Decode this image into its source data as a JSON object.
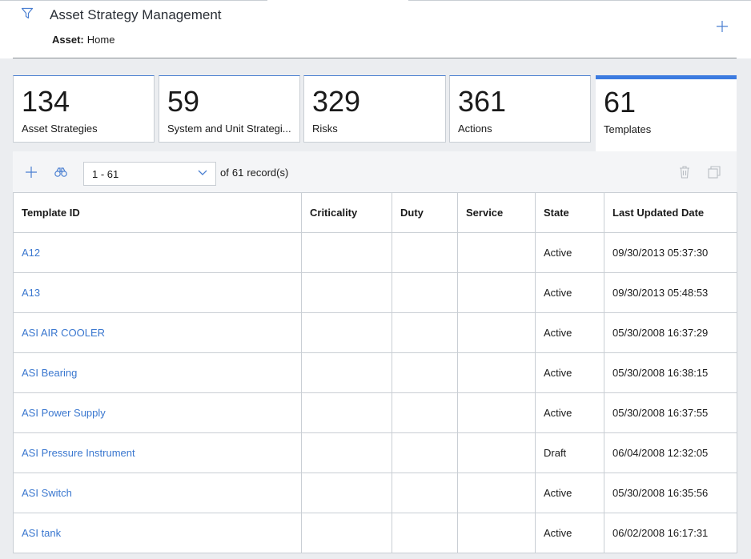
{
  "header": {
    "title": "Asset Strategy Management",
    "asset_label": "Asset:",
    "asset_value": "Home"
  },
  "cards": [
    {
      "count": "134",
      "label": "Asset Strategies"
    },
    {
      "count": "59",
      "label": "System and Unit Strategi..."
    },
    {
      "count": "329",
      "label": "Risks"
    },
    {
      "count": "361",
      "label": "Actions"
    },
    {
      "count": "61",
      "label": "Templates",
      "active": true
    }
  ],
  "toolbar": {
    "pager_value": "1 - 61",
    "of_label": "of",
    "total": "61",
    "records_label": "record(s)"
  },
  "table": {
    "columns": [
      "Template ID",
      "Criticality",
      "Duty",
      "Service",
      "State",
      "Last Updated Date"
    ],
    "rows": [
      {
        "id": "A12",
        "criticality": "",
        "duty": "",
        "service": "",
        "state": "Active",
        "updated": "09/30/2013 05:37:30"
      },
      {
        "id": "A13",
        "criticality": "",
        "duty": "",
        "service": "",
        "state": "Active",
        "updated": "09/30/2013 05:48:53"
      },
      {
        "id": "ASI AIR COOLER",
        "criticality": "",
        "duty": "",
        "service": "",
        "state": "Active",
        "updated": "05/30/2008 16:37:29"
      },
      {
        "id": "ASI Bearing",
        "criticality": "",
        "duty": "",
        "service": "",
        "state": "Active",
        "updated": "05/30/2008 16:38:15"
      },
      {
        "id": "ASI Power Supply",
        "criticality": "",
        "duty": "",
        "service": "",
        "state": "Active",
        "updated": "05/30/2008 16:37:55"
      },
      {
        "id": "ASI Pressure Instrument",
        "criticality": "",
        "duty": "",
        "service": "",
        "state": "Draft",
        "updated": "06/04/2008 12:32:05"
      },
      {
        "id": "ASI Switch",
        "criticality": "",
        "duty": "",
        "service": "",
        "state": "Active",
        "updated": "05/30/2008 16:35:56"
      },
      {
        "id": "ASI tank",
        "criticality": "",
        "duty": "",
        "service": "",
        "state": "Active",
        "updated": "06/02/2008 16:17:31"
      }
    ]
  },
  "colors": {
    "accent": "#3c7be0",
    "link": "#3a77cf",
    "border": "#c9ced4"
  },
  "icons": [
    "filter-icon",
    "add-icon",
    "binoculars-icon",
    "chevron-down-icon",
    "trash-icon",
    "copy-icon"
  ]
}
